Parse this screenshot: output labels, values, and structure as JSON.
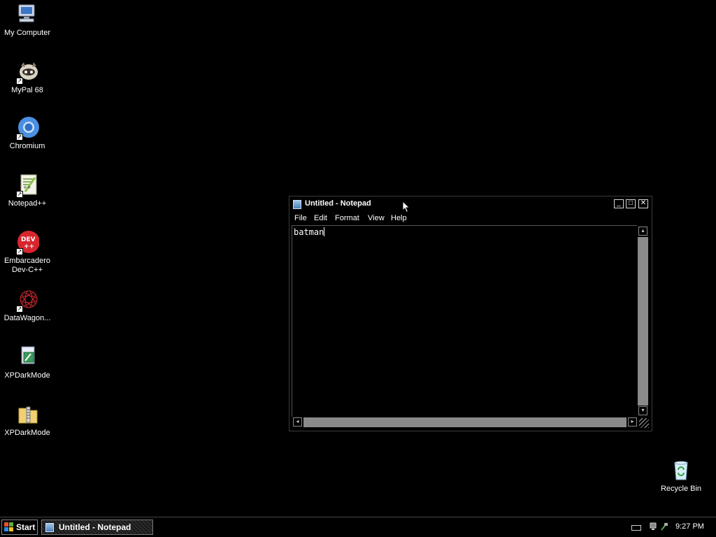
{
  "desktop": {
    "icons": [
      {
        "label": "My Computer",
        "icon": "computer-icon"
      },
      {
        "label": "MyPal 68",
        "icon": "mypal-raccoon-icon"
      },
      {
        "label": "Chromium",
        "icon": "chromium-icon"
      },
      {
        "label": "Notepad++",
        "icon": "notepadpp-icon"
      },
      {
        "label": "Embarcadero Dev-C++",
        "icon": "devcpp-icon",
        "badge": "DEV ++"
      },
      {
        "label": "DataWagon...",
        "icon": "datawagon-icon"
      },
      {
        "label": "XPDarkMode",
        "icon": "xpdarkmode-app-icon"
      },
      {
        "label": "XPDarkMode",
        "icon": "zip-folder-icon"
      },
      {
        "label": "Recycle Bin",
        "icon": "recycle-bin-icon"
      }
    ]
  },
  "notepad": {
    "title": "Untitled - Notepad",
    "menu": [
      "File",
      "Edit",
      "Format",
      "View",
      "Help"
    ],
    "content": "batman",
    "controls": {
      "minimize": "_",
      "maximize": "□",
      "close": "✕"
    }
  },
  "taskbar": {
    "start_label": "Start",
    "task_label": "Untitled - Notepad",
    "clock": "9:27 PM"
  },
  "colors": {
    "desktop_bg": "#000000",
    "scrollbar": "#8a8a8a",
    "text": "#ffffff",
    "devcpp_red": "#d7262e",
    "chromium_blue": "#4a8fe0"
  }
}
